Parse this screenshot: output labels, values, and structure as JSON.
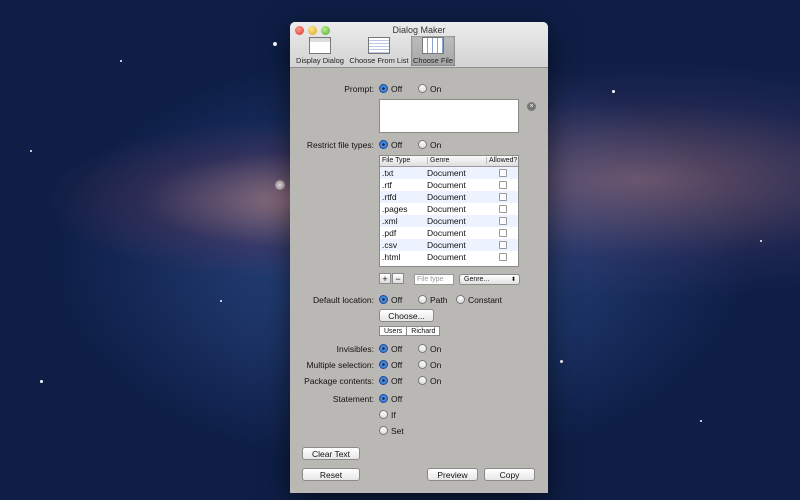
{
  "window": {
    "title": "Dialog Maker"
  },
  "toolbar": {
    "items": [
      {
        "label": "Display Dialog",
        "icon": "dialog-icon"
      },
      {
        "label": "Choose From List",
        "icon": "list-icon"
      },
      {
        "label": "Choose File",
        "icon": "file-grid-icon"
      }
    ]
  },
  "form": {
    "prompt": {
      "label": "Prompt:",
      "off": "Off",
      "on": "On"
    },
    "restrict": {
      "label": "Restrict file types:",
      "off": "Off",
      "on": "On"
    },
    "table": {
      "columns": [
        "File Type",
        "Genre",
        "Allowed?"
      ],
      "rows": [
        {
          "type": ".txt",
          "genre": "Document"
        },
        {
          "type": ".rtf",
          "genre": "Document"
        },
        {
          "type": ".rtfd",
          "genre": "Document"
        },
        {
          "type": ".pages",
          "genre": "Document"
        },
        {
          "type": ".xml",
          "genre": "Document"
        },
        {
          "type": ".pdf",
          "genre": "Document"
        },
        {
          "type": ".csv",
          "genre": "Document"
        },
        {
          "type": ".html",
          "genre": "Document"
        }
      ]
    },
    "add_label": "+",
    "remove_label": "−",
    "filetype_placeholder": "File type",
    "genre_popup": "Genre...",
    "default_location": {
      "label": "Default location:",
      "off": "Off",
      "path": "Path",
      "constant": "Constant"
    },
    "choose_button": "Choose...",
    "path": [
      "Users",
      "Richard"
    ],
    "invisibles": {
      "label": "Invisibles:",
      "off": "Off",
      "on": "On"
    },
    "multiple": {
      "label": "Multiple selection:",
      "off": "Off",
      "on": "On"
    },
    "package": {
      "label": "Package contents:",
      "off": "Off",
      "on": "On"
    },
    "statement": {
      "label": "Statement:",
      "off": "Off",
      "if": "If",
      "set": "Set"
    }
  },
  "buttons": {
    "clear_text": "Clear Text",
    "reset": "Reset",
    "preview": "Preview",
    "copy": "Copy"
  }
}
